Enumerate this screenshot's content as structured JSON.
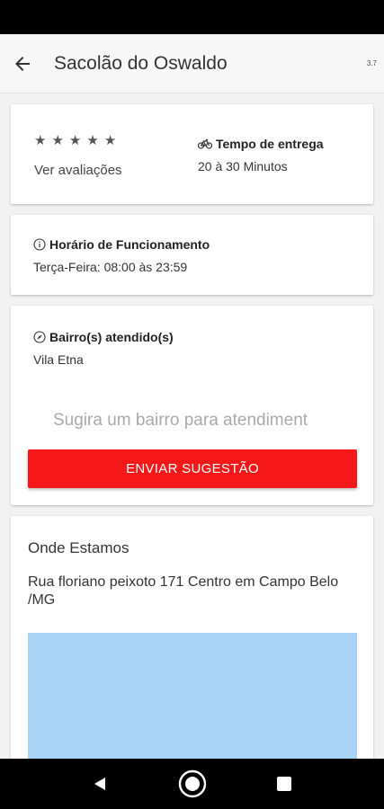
{
  "app_bar": {
    "title": "Sacolão do Oswaldo",
    "version": "3.7",
    "back_icon": "arrow-left-icon"
  },
  "summary": {
    "rating_stars": 5,
    "ratings_link": "Ver avaliações",
    "delivery_title": "Tempo de entrega",
    "delivery_value": "20 à 30 Minutos",
    "delivery_icon": "bicycle-icon"
  },
  "hours": {
    "title": "Horário de Funcionamento",
    "value": "Terça-Feira: 08:00 às 23:59",
    "icon": "info-circle-icon"
  },
  "neighborhoods": {
    "title": "Bairro(s) atendido(s)",
    "value": "Vila Etna",
    "icon": "compass-icon",
    "suggest_placeholder": "Sugira um bairro para atendiment",
    "send_button": "ENVIAR SUGESTÃO"
  },
  "location": {
    "title": "Onde Estamos",
    "address": "Rua floriano peixoto 171 Centro em Campo Belo /MG"
  },
  "colors": {
    "accent": "#f41818",
    "map": "#a9d2f7"
  }
}
